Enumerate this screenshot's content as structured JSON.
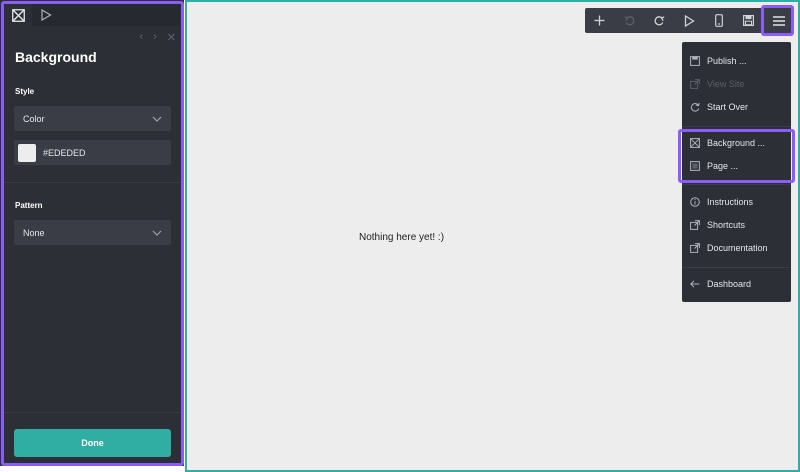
{
  "panel": {
    "title": "Background",
    "style_label": "Style",
    "style_value": "Color",
    "color_value": "#EDEDED",
    "pattern_label": "Pattern",
    "pattern_value": "None",
    "done_label": "Done",
    "swatch_color": "#ededed"
  },
  "canvas": {
    "empty_text": "Nothing here yet! :)"
  },
  "toolbar": {
    "icons": [
      "add-icon",
      "undo-icon",
      "redo-icon",
      "play-icon",
      "mobile-icon",
      "save-icon",
      "menu-icon"
    ]
  },
  "menu": {
    "items": [
      {
        "label": "Publish ...",
        "icon": "publish-icon",
        "enabled": true
      },
      {
        "label": "View Site",
        "icon": "external-link-icon",
        "enabled": false
      },
      {
        "label": "Start Over",
        "icon": "refresh-icon",
        "enabled": true
      },
      {
        "label": "Background ...",
        "icon": "background-icon",
        "enabled": true
      },
      {
        "label": "Page ...",
        "icon": "page-icon",
        "enabled": true
      },
      {
        "label": "Instructions",
        "icon": "info-icon",
        "enabled": true
      },
      {
        "label": "Shortcuts",
        "icon": "external-link-icon",
        "enabled": true
      },
      {
        "label": "Documentation",
        "icon": "external-link-icon",
        "enabled": true
      },
      {
        "label": "Dashboard",
        "icon": "arrow-left-icon",
        "enabled": true
      }
    ]
  },
  "colors": {
    "panel_bg": "#2c2f36",
    "accent": "#31aea3",
    "highlight": "#8b5cf6",
    "canvas_bg": "#ededed"
  }
}
